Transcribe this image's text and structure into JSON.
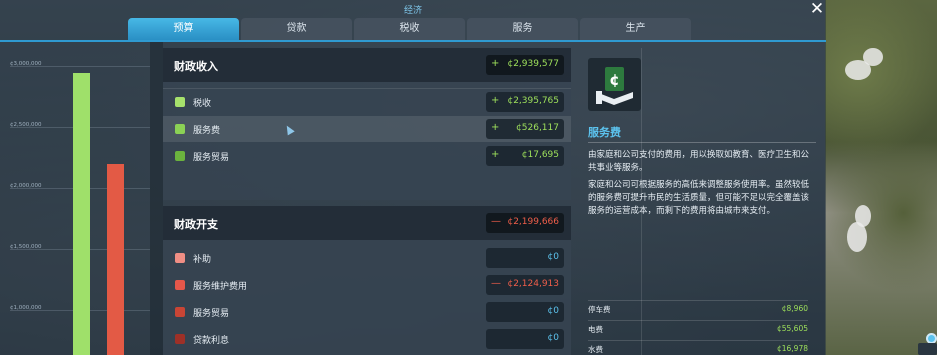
{
  "window": {
    "title": "经济",
    "close_label": "✕"
  },
  "tabs": [
    {
      "label": "预算",
      "active": true
    },
    {
      "label": "贷款",
      "active": false
    },
    {
      "label": "税收",
      "active": false
    },
    {
      "label": "服务",
      "active": false
    },
    {
      "label": "生产",
      "active": false
    }
  ],
  "chart_data": {
    "type": "bar",
    "y_ticks": [
      "¢3,000,000",
      "¢2,500,000",
      "¢2,000,000",
      "¢1,500,000",
      "¢1,000,000"
    ],
    "series": [
      {
        "value": 2939577,
        "color": "#9fe06a"
      },
      {
        "value": 2199666,
        "color": "#e35a45"
      }
    ]
  },
  "income": {
    "title": "财政收入",
    "total_sign": "+",
    "total": "¢2,939,577",
    "rows": [
      {
        "label": "税收",
        "sign": "+",
        "value": "¢2,395,765",
        "color": "#a6e16c"
      },
      {
        "label": "服务费",
        "sign": "+",
        "value": "¢526,117",
        "color": "#8bd155"
      },
      {
        "label": "服务贸易",
        "sign": "+",
        "value": "¢17,695",
        "color": "#6bb33e"
      }
    ]
  },
  "expense": {
    "title": "财政开支",
    "total_sign": "—",
    "total": "¢2,199,666",
    "rows": [
      {
        "label": "补助",
        "sign": "",
        "value": "¢0",
        "color": "#f08e84"
      },
      {
        "label": "服务维护费用",
        "sign": "—",
        "value": "¢2,124,913",
        "color": "#e5574a"
      },
      {
        "label": "服务贸易",
        "sign": "",
        "value": "¢0",
        "color": "#c94535"
      },
      {
        "label": "贷款利息",
        "sign": "",
        "value": "¢0",
        "color": "#9e3027"
      }
    ]
  },
  "info": {
    "icon": "service-fee-icon",
    "title": "服务费",
    "para1": "由家庭和公司支付的费用，用以换取如教育、医疗卫生和公共事业等服务。",
    "para2": "家庭和公司可根据服务的高低来调整服务使用率。虽然较低的服务费可提升市民的生活质量，但可能不足以完全覆盖该服务的运营成本，而剩下的费用将由城市来支付。",
    "stats": [
      {
        "label": "停车费",
        "value": "¢8,960"
      },
      {
        "label": "电费",
        "value": "¢55,605"
      },
      {
        "label": "水费",
        "value": "¢16,978"
      }
    ]
  }
}
